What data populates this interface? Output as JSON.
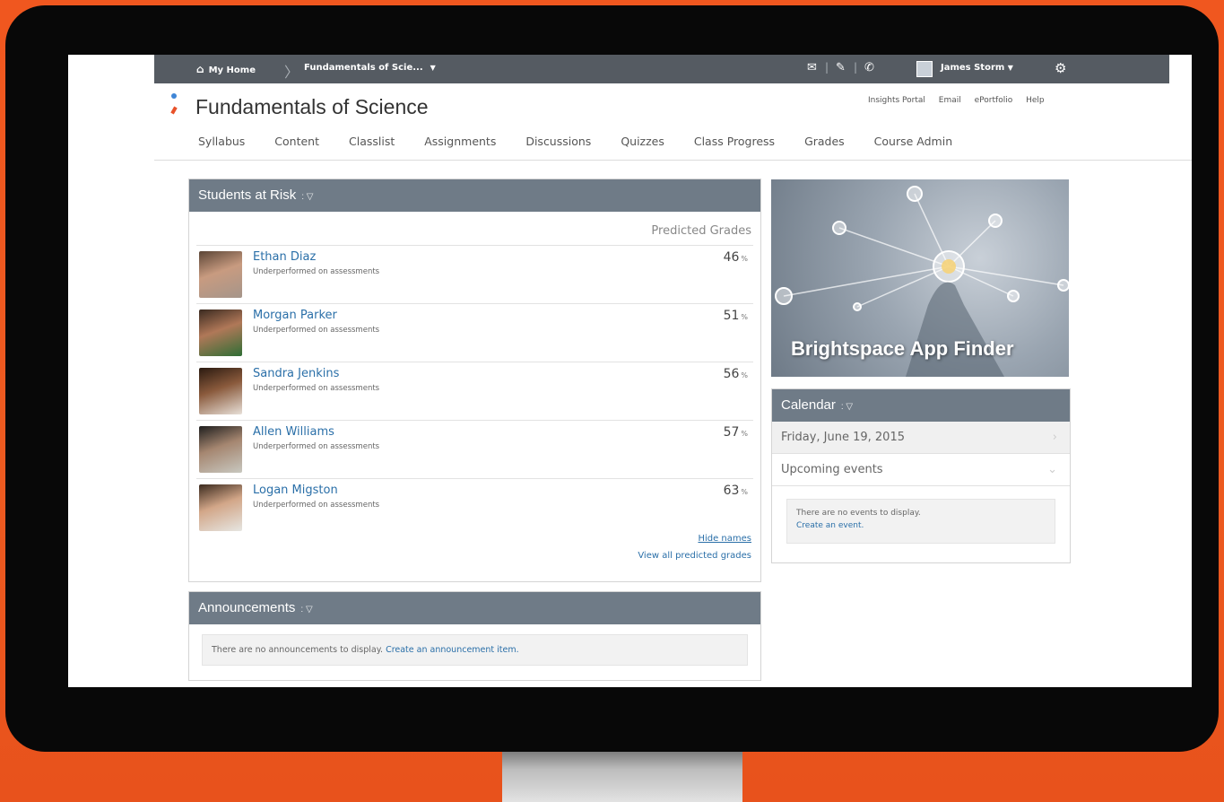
{
  "topbar": {
    "home_label": "My Home",
    "course_label": "Fundamentals of Scie...",
    "user_name": "James Storm",
    "icons": [
      "mail-icon",
      "notebook-icon",
      "chat-icon",
      "gear-icon"
    ]
  },
  "course": {
    "title": "Fundamentals of Science",
    "utility_links": [
      "Insights Portal",
      "Email",
      "ePortfolio",
      "Help"
    ],
    "nav": [
      "Syllabus",
      "Content",
      "Classlist",
      "Assignments",
      "Discussions",
      "Quizzes",
      "Class Progress",
      "Grades",
      "Course Admin"
    ]
  },
  "risk_widget": {
    "title": "Students at Risk",
    "column_header": "Predicted Grades",
    "students": [
      {
        "name": "Ethan Diaz",
        "note": "Underperformed on assessments",
        "grade": "46",
        "unit": "%"
      },
      {
        "name": "Morgan Parker",
        "note": "Underperformed on assessments",
        "grade": "51",
        "unit": "%"
      },
      {
        "name": "Sandra Jenkins",
        "note": "Underperformed on assessments",
        "grade": "56",
        "unit": "%"
      },
      {
        "name": "Allen Williams",
        "note": "Underperformed on assessments",
        "grade": "57",
        "unit": "%"
      },
      {
        "name": "Logan Migston",
        "note": "Underperformed on assessments",
        "grade": "63",
        "unit": "%"
      }
    ],
    "hide_names": "Hide names",
    "view_all": "View all predicted grades"
  },
  "announcements": {
    "title": "Announcements",
    "empty_text": "There are no announcements to display.",
    "create_link": "Create an announcement item."
  },
  "promo": {
    "text": "Brightspace App Finder"
  },
  "calendar": {
    "title": "Calendar",
    "date": "Friday, June 19, 2015",
    "upcoming": "Upcoming events",
    "empty_text": "There are no events to display.",
    "create_link": "Create an event."
  }
}
